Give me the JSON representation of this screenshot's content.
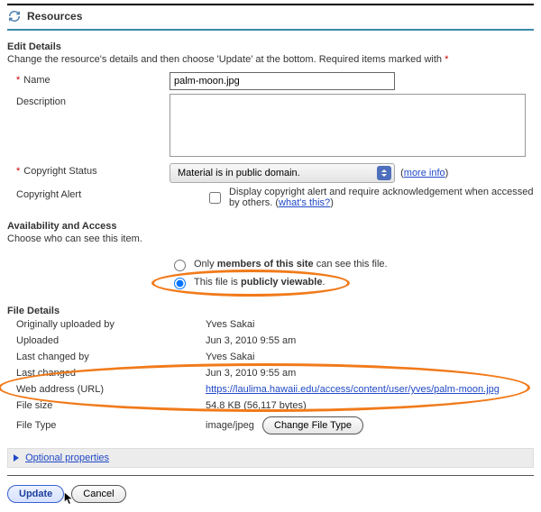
{
  "header": {
    "title": "Resources"
  },
  "edit": {
    "section_title": "Edit Details",
    "intro": "Change the resource's details and then choose 'Update' at the bottom. Required items marked with",
    "name_label": "Name",
    "name_value": "palm-moon.jpg",
    "desc_label": "Description",
    "desc_value": "",
    "copyright_label": "Copyright Status",
    "copyright_selected": "Material is in public domain.",
    "more_info": "more info",
    "alert_label": "Copyright Alert",
    "alert_text": "Display copyright alert and require acknowledgement when accessed by others.",
    "whats_this": "what's this?"
  },
  "avail": {
    "title": "Availability and Access",
    "subtitle": "Choose who can see this item.",
    "opt1_pre": "Only ",
    "opt1_bold": "members of this site",
    "opt1_post": " can see this file.",
    "opt2_pre": "This file is ",
    "opt2_bold": "publicly viewable",
    "opt2_post": "."
  },
  "file": {
    "title": "File Details",
    "uploader_label": "Originally uploaded by",
    "uploader_value": "Yves Sakai",
    "uploaded_label": "Uploaded",
    "uploaded_value": "Jun 3, 2010 9:55 am",
    "changer_label": "Last changed by",
    "changer_value": "Yves Sakai",
    "changed_label": "Last changed",
    "changed_value": "Jun 3, 2010 9:55 am",
    "url_label": "Web address (URL)",
    "url_value": "https://laulima.hawaii.edu/access/content/user/yves/palm-moon.jpg",
    "size_label": "File size",
    "size_value": "54.8 KB (56,117 bytes)",
    "type_label": "File Type",
    "type_value": "image/jpeg",
    "change_type_btn": "Change File Type"
  },
  "opt_props": "Optional properties",
  "buttons": {
    "update": "Update",
    "cancel": "Cancel"
  }
}
